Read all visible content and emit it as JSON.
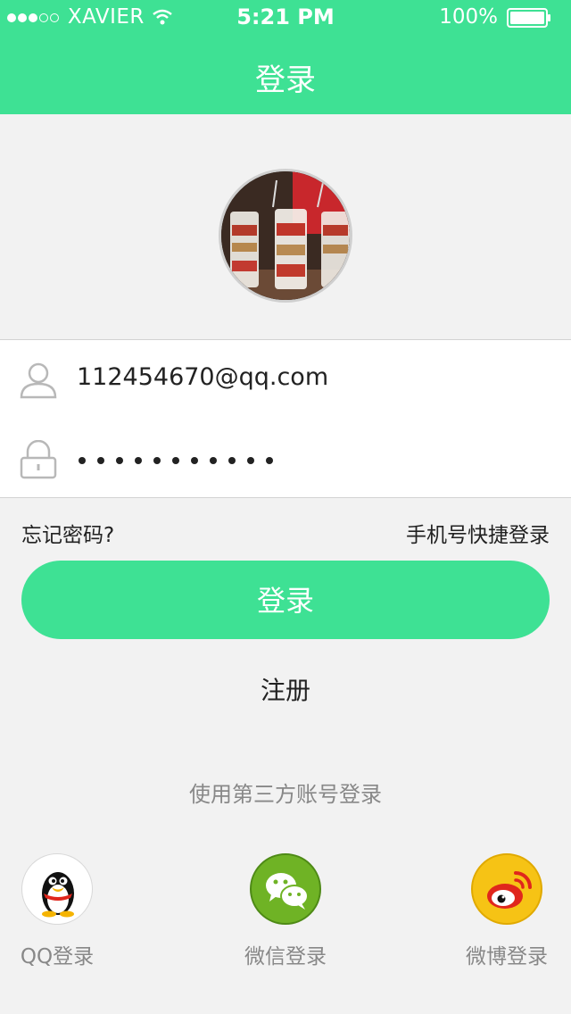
{
  "status_bar": {
    "carrier": "XAVIER",
    "time": "5:21 PM",
    "battery": "100%"
  },
  "header": {
    "title": "登录"
  },
  "avatar": {
    "icon": "dessert-photo"
  },
  "form": {
    "username": {
      "value": "112454670@qq.com",
      "icon": "user-icon"
    },
    "password": {
      "masked": "•••••••••••",
      "icon": "lock-icon"
    }
  },
  "links": {
    "forgot": "忘记密码?",
    "phone_login": "手机号快捷登录"
  },
  "login_button": "登录",
  "register": "注册",
  "third_party": {
    "title": "使用第三方账号登录",
    "items": [
      {
        "label": "QQ登录",
        "icon": "qq-penguin-icon"
      },
      {
        "label": "微信登录",
        "icon": "wechat-icon"
      },
      {
        "label": "微博登录",
        "icon": "weibo-icon"
      }
    ]
  },
  "colors": {
    "accent": "#3ee194",
    "background": "#f2f2f2",
    "muted_text": "#888888"
  }
}
